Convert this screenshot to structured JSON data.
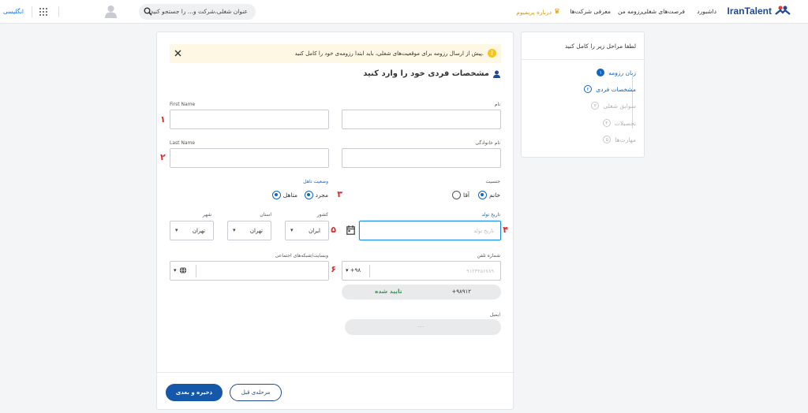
{
  "topbar": {
    "logo": "IranTalent",
    "nav": [
      "داشبورد",
      "فرصت‌های شغلی",
      "رزومه من",
      "معرفی شرکت‌ها"
    ],
    "premium": "درباره پریمیوم",
    "search_placeholder": "عنوان شغلی،شرکت و... را جستجو کنید",
    "language": "انگلیسی"
  },
  "sidebar": {
    "title": "لطفا مراحل زیر را کامل کنید",
    "steps": [
      {
        "num": "۱",
        "label": "زبان رزومه",
        "state": "done"
      },
      {
        "num": "۲",
        "label": "مشخصات فردی",
        "state": "current"
      },
      {
        "num": "۳",
        "label": "سوابق شغلی",
        "state": "pending"
      },
      {
        "num": "۴",
        "label": "تحصیلات",
        "state": "pending"
      },
      {
        "num": "۵",
        "label": "مهارت‌ها",
        "state": "pending"
      }
    ]
  },
  "alert": {
    "text": "پیش از ارسال رزومه برای موقعیت‌های شغلی، باید ابتدا رزومه‌ی خود را کامل کنید."
  },
  "form": {
    "heading": "مشخصات فردی خود را وارد کنید",
    "labels": {
      "first_name_en": "First Name",
      "first_name_fa": "نام",
      "last_name_en": "Last Name",
      "last_name_fa": "نام خانوادگی",
      "gender": "جنسیت",
      "marital": "وضعیت تاهل",
      "birthdate": "تاریخ تولد",
      "country": "کشور",
      "province": "استان",
      "city": "شهر",
      "phone": "شماره تلفن",
      "website": "وبسایت/شبکه‌های اجتماعی",
      "email": "ایمیل"
    },
    "gender_options": [
      "خانم",
      "آقا"
    ],
    "marital_options": [
      "مجرد",
      "متاهل"
    ],
    "birthdate_placeholder": "تاریخ تولد",
    "country_value": "ایران",
    "province_value": "تهران",
    "city_value": "تهران",
    "phone_code": "+۹۸",
    "phone_placeholder": "۹۱۲۳۴۵۶۷۸۹",
    "verify_number": "+۹۸۹۱۲",
    "verify_label": "تایید شده",
    "email_placeholder": "....",
    "markers": [
      "۱",
      "۲",
      "۳",
      "۴",
      "۵",
      "۶"
    ]
  },
  "buttons": {
    "prev": "مرحله‌ی قبل",
    "next": "ذخیره و بعدی"
  },
  "colors": {
    "brand": "#22489a",
    "primary": "#1565c0",
    "success": "#2e9e4f",
    "premium": "#d49b00",
    "alert_bg": "#fdf7e3",
    "marker": "#d32f2f"
  }
}
